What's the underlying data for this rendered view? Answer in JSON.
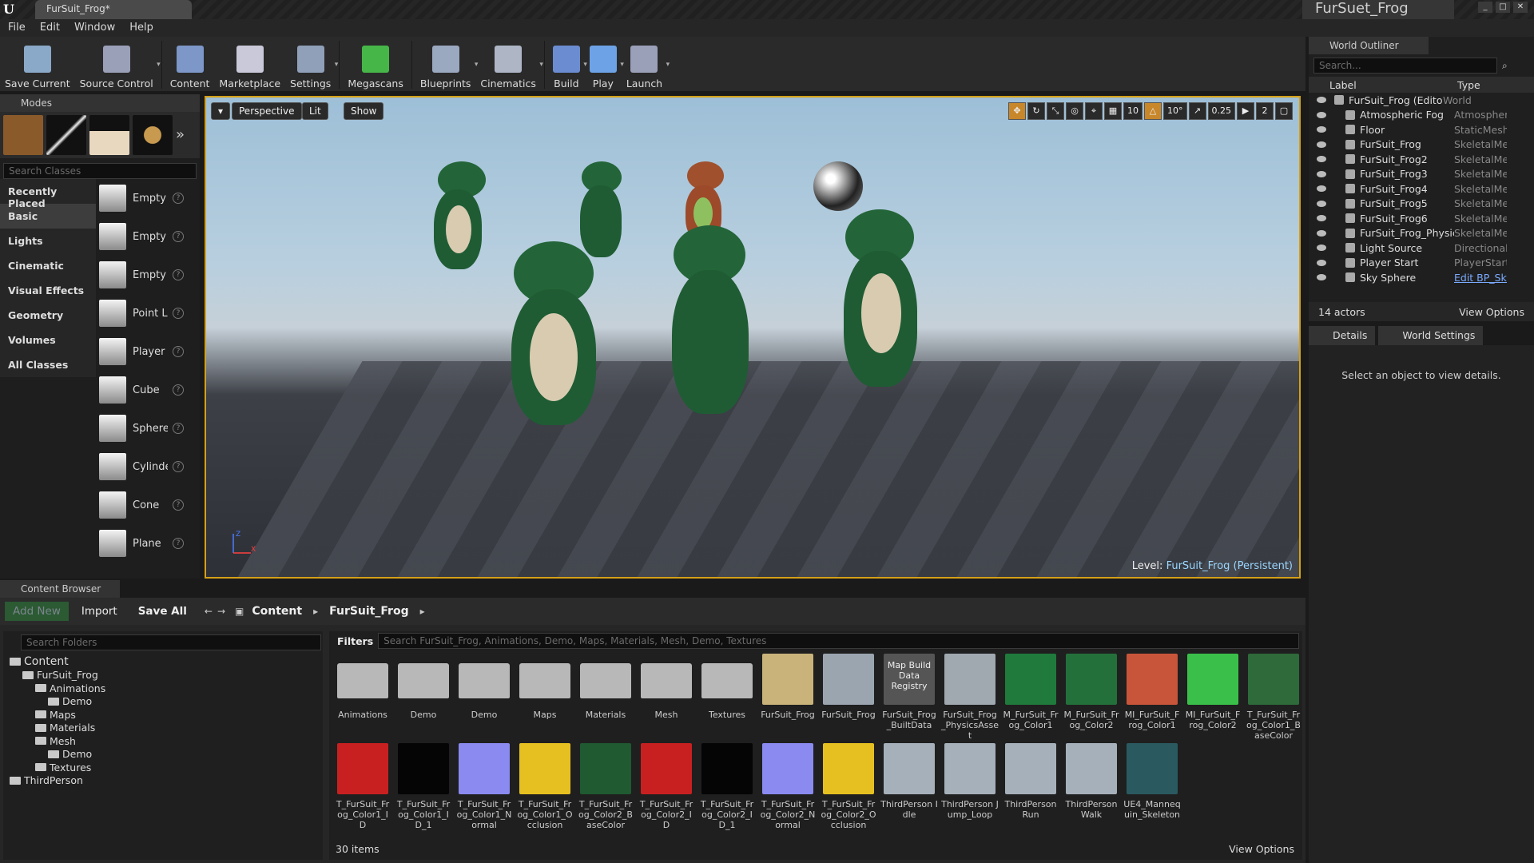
{
  "window": {
    "tab_title": "FurSuit_Frog*",
    "project_name": "FurSuet_Frog"
  },
  "menu": [
    "File",
    "Edit",
    "Window",
    "Help"
  ],
  "toolbar": [
    {
      "label": "Save Current",
      "icon": "save-icon",
      "color": "#8aa8c8"
    },
    {
      "label": "Source Control",
      "icon": "source-control-icon",
      "color": "#9aa0b8",
      "dropdown": true
    },
    {
      "label": "Content",
      "icon": "content-icon",
      "color": "#7c97c8"
    },
    {
      "label": "Marketplace",
      "icon": "marketplace-icon",
      "color": "#c9c9d9"
    },
    {
      "label": "Settings",
      "icon": "settings-icon",
      "color": "#8fa0b8",
      "dropdown": true
    },
    {
      "label": "Megascans",
      "icon": "megascans-icon",
      "color": "#46b648"
    },
    {
      "label": "Blueprints",
      "icon": "blueprints-icon",
      "color": "#9aa8c0",
      "dropdown": true
    },
    {
      "label": "Cinematics",
      "icon": "cinematics-icon",
      "color": "#aeb6c6",
      "dropdown": true
    },
    {
      "label": "Build",
      "icon": "build-icon",
      "color": "#6b8cd0",
      "dropdown": true
    },
    {
      "label": "Play",
      "icon": "play-icon",
      "color": "#6da3e6",
      "dropdown": true
    },
    {
      "label": "Launch",
      "icon": "launch-icon",
      "color": "#9aa0b8",
      "dropdown": true
    }
  ],
  "modes": {
    "title": "Modes",
    "search_placeholder": "Search Classes",
    "categories": [
      "Recently Placed",
      "Basic",
      "Lights",
      "Cinematic",
      "Visual Effects",
      "Geometry",
      "Volumes",
      "All Classes"
    ],
    "selected_category": "Basic",
    "items": [
      "Empty",
      "Empty",
      "Empty",
      "Point L",
      "Player",
      "Cube",
      "Sphere",
      "Cylinde",
      "Cone",
      "Plane"
    ]
  },
  "viewport": {
    "menu_btn": "▾",
    "perspective": "Perspective",
    "lit": "Lit",
    "show": "Show",
    "grid_snap": "10",
    "rot_snap": "10°",
    "scale_snap": "0.25",
    "camera_speed": "2",
    "level_label": "Level:",
    "level_name": "FurSuit_Frog (Persistent)",
    "axis_z": "Z",
    "axis_x": "X"
  },
  "outliner": {
    "title": "World Outliner",
    "search_placeholder": "Search...",
    "col_label": "Label",
    "col_type": "Type",
    "rows": [
      {
        "label": "FurSuit_Frog (Editor)",
        "type": "World"
      },
      {
        "label": "Atmospheric Fog",
        "type": "AtmosphericFog"
      },
      {
        "label": "Floor",
        "type": "StaticMeshActor"
      },
      {
        "label": "FurSuit_Frog",
        "type": "SkeletalMeshActor"
      },
      {
        "label": "FurSuit_Frog2",
        "type": "SkeletalMeshActor"
      },
      {
        "label": "FurSuit_Frog3",
        "type": "SkeletalMeshActor"
      },
      {
        "label": "FurSuit_Frog4",
        "type": "SkeletalMeshActor"
      },
      {
        "label": "FurSuit_Frog5",
        "type": "SkeletalMeshActor"
      },
      {
        "label": "FurSuit_Frog6",
        "type": "SkeletalMeshActor"
      },
      {
        "label": "FurSuit_Frog_PhysicsAsset",
        "type": "SkeletalMeshActor"
      },
      {
        "label": "Light Source",
        "type": "DirectionalLight"
      },
      {
        "label": "Player Start",
        "type": "PlayerStart"
      },
      {
        "label": "Sky Sphere",
        "type": "Edit BP_Sky"
      }
    ],
    "actor_count": "14 actors",
    "view_options": "View Options"
  },
  "details": {
    "tab_details": "Details",
    "tab_world": "World Settings",
    "empty_msg": "Select an object to view details."
  },
  "content_browser": {
    "tab": "Content Browser",
    "add_new": "Add New",
    "import": "Import",
    "save_all": "Save All",
    "path": [
      "Content",
      "FurSuit_Frog"
    ],
    "folder_search": "Search Folders",
    "filters": "Filters",
    "asset_search": "Search FurSuit_Frog, Animations, Demo, Maps, Materials, Mesh, Demo, Textures",
    "tree": [
      {
        "label": "Content",
        "depth": 0
      },
      {
        "label": "FurSuit_Frog",
        "depth": 1
      },
      {
        "label": "Animations",
        "depth": 2
      },
      {
        "label": "Demo",
        "depth": 3
      },
      {
        "label": "Maps",
        "depth": 2
      },
      {
        "label": "Materials",
        "depth": 2
      },
      {
        "label": "Mesh",
        "depth": 2
      },
      {
        "label": "Demo",
        "depth": 3
      },
      {
        "label": "Textures",
        "depth": 2
      },
      {
        "label": "ThirdPerson",
        "depth": 0
      }
    ],
    "assets": [
      {
        "name": "Animations",
        "color": "#b8b8b8"
      },
      {
        "name": "Demo",
        "color": "#b8b8b8"
      },
      {
        "name": "Demo",
        "color": "#b8b8b8"
      },
      {
        "name": "Maps",
        "color": "#b8b8b8"
      },
      {
        "name": "Materials",
        "color": "#b8b8b8"
      },
      {
        "name": "Mesh",
        "color": "#b8b8b8"
      },
      {
        "name": "Textures",
        "color": "#b8b8b8"
      },
      {
        "name": "FurSuit_Frog",
        "color": "#c9b37a"
      },
      {
        "name": "FurSuit_Frog",
        "color": "#9aa5b0"
      },
      {
        "name": "FurSuit_Frog_BuiltData",
        "color": "#555555"
      },
      {
        "name": "FurSuit_Frog_PhysicsAsset",
        "color": "#a0a8b0"
      },
      {
        "name": "M_FurSuit_Frog_Color1",
        "color": "#1f7a3c"
      },
      {
        "name": "M_FurSuit_Frog_Color2",
        "color": "#24703a"
      },
      {
        "name": "MI_FurSuit_Frog_Color1",
        "color": "#c8553a"
      },
      {
        "name": "MI_FurSuit_Frog_Color2",
        "color": "#3ac04a"
      },
      {
        "name": "T_FurSuit_Frog_Color1_BaseColor",
        "color": "#2e6a3a"
      },
      {
        "name": "T_FurSuit_Frog_Color1_ID",
        "color": "#c82020"
      },
      {
        "name": "T_FurSuit_Frog_Color1_ID_1",
        "color": "#050505"
      },
      {
        "name": "T_FurSuit_Frog_Color1_Normal",
        "color": "#8a8af0"
      },
      {
        "name": "T_FurSuit_Frog_Color1_Occlusion",
        "color": "#e6c020"
      },
      {
        "name": "T_FurSuit_Frog_Color2_BaseColor",
        "color": "#1f5a30"
      },
      {
        "name": "T_FurSuit_Frog_Color2_ID",
        "color": "#c82020"
      },
      {
        "name": "T_FurSuit_Frog_Color2_ID_1",
        "color": "#050505"
      },
      {
        "name": "T_FurSuit_Frog_Color2_Normal",
        "color": "#8a8af0"
      },
      {
        "name": "T_FurSuit_Frog_Color2_Occlusion",
        "color": "#e6c020"
      },
      {
        "name": "ThirdPerson Idle",
        "color": "#a5b0ba"
      },
      {
        "name": "ThirdPerson Jump_Loop",
        "color": "#a5b0ba"
      },
      {
        "name": "ThirdPerson Run",
        "color": "#a5b0ba"
      },
      {
        "name": "ThirdPerson Walk",
        "color": "#a5b0ba"
      },
      {
        "name": "UE4_Mannequin_Skeleton",
        "color": "#2a5a60"
      }
    ],
    "built_data_label": "Map Build Data Registry",
    "item_count": "30 items",
    "view_options": "View Options"
  }
}
